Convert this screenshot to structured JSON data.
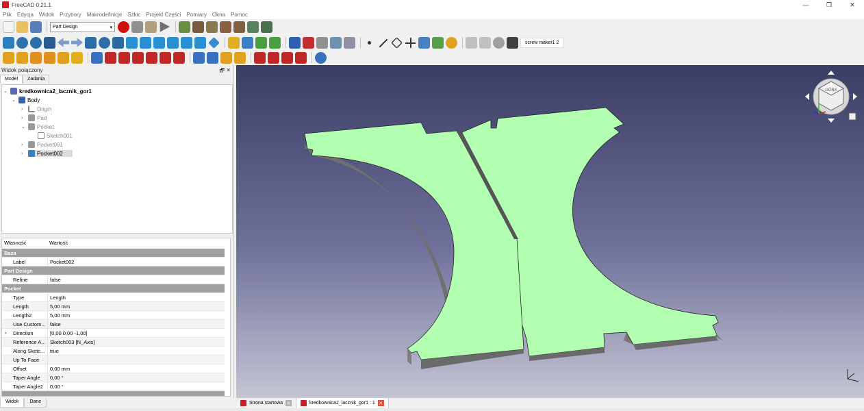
{
  "window": {
    "title": "FreeCAD 0.21.1",
    "minimize": "—",
    "maximize": "❐",
    "close": "✕"
  },
  "menu": [
    "Plik",
    "Edycja",
    "Widok",
    "Przybory",
    "Makrodefinicje",
    "Szkic",
    "Projekt Części",
    "Pomiary",
    "Okna",
    "Pomoc"
  ],
  "toolbar": {
    "workbench": "Part Design",
    "macro_label": "screw maker1 2"
  },
  "combo_view": {
    "title": "Widok połączony",
    "tab_model": "Model",
    "tab_tasks": "Zadania"
  },
  "tree": {
    "document": "kredkownica2_lacznik_gor1",
    "body": "Body",
    "origin": "Origin",
    "pad": "Pad",
    "pocket": "Pocket",
    "sketch": "Sketch001",
    "pocket001": "Pocket001",
    "pocket002": "Pocket002"
  },
  "props": {
    "col_property": "Własność",
    "col_value": "Wartość",
    "g_base": "Baza",
    "label_k": "Label",
    "label_v": "Pocket002",
    "g_pd": "Part Design",
    "refine_k": "Refine",
    "refine_v": "false",
    "g_pocket": "Pocket",
    "type_k": "Type",
    "type_v": "Length",
    "length_k": "Length",
    "length_v": "5,00 mm",
    "length2_k": "Length2",
    "length2_v": "5,00 mm",
    "usecustom_k": "Use Custom...",
    "usecustom_v": "false",
    "direction_k": "Direction",
    "direction_v": "[0,00 0,00 -1,00]",
    "refaxis_k": "Reference A...",
    "refaxis_v": "Sketch003 [N_Axis]",
    "along_k": "Along Sketc...",
    "along_v": "true",
    "uptoface_k": "Up To Face",
    "uptoface_v": "",
    "offset_k": "Offset",
    "offset_v": "0,00 mm",
    "taper_k": "Taper Angle",
    "taper_v": "0,00 °",
    "taper2_k": "Taper Angle2",
    "taper2_v": "0,00 °"
  },
  "bottom_tabs": {
    "view": "Widok",
    "data": "Dane"
  },
  "doc_tabs": {
    "start": "Strona startowa",
    "doc": "kredkownica2_lacznik_gor1 : 1"
  },
  "navcube": {
    "face_label": "GÓRA"
  },
  "colors": {
    "part_face": "#b2ffb2",
    "part_side": "#7a7a7a",
    "viewport_top": "#3a3d64",
    "viewport_bottom": "#c4c5d4"
  }
}
